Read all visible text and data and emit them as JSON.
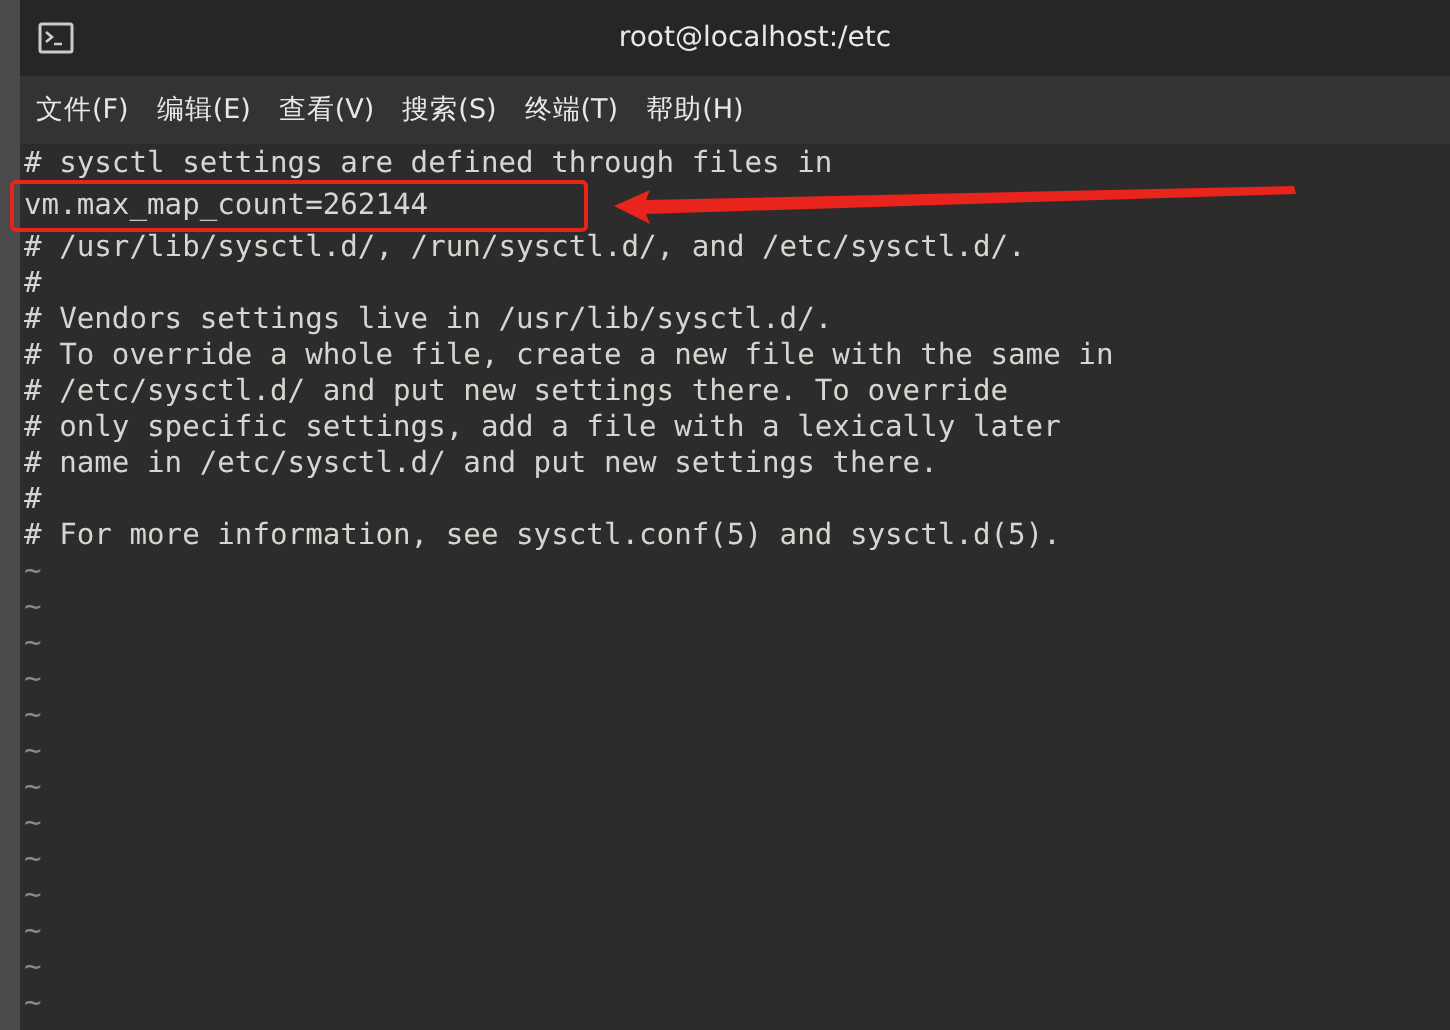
{
  "window": {
    "title": "root@localhost:/etc"
  },
  "menu": [
    "文件(F)",
    "编辑(E)",
    "查看(V)",
    "搜索(S)",
    "终端(T)",
    "帮助(H)"
  ],
  "lines": [
    {
      "text": "# sysctl settings are defined through files in",
      "highlighted": false
    },
    {
      "text": "vm.max_map_count=262144",
      "highlighted": true
    },
    {
      "text": "# /usr/lib/sysctl.d/, /run/sysctl.d/, and /etc/sysctl.d/.",
      "highlighted": false
    },
    {
      "text": "#",
      "highlighted": false
    },
    {
      "text": "# Vendors settings live in /usr/lib/sysctl.d/.",
      "highlighted": false
    },
    {
      "text": "# To override a whole file, create a new file with the same in",
      "highlighted": false
    },
    {
      "text": "# /etc/sysctl.d/ and put new settings there. To override",
      "highlighted": false
    },
    {
      "text": "# only specific settings, add a file with a lexically later",
      "highlighted": false
    },
    {
      "text": "# name in /etc/sysctl.d/ and put new settings there.",
      "highlighted": false
    },
    {
      "text": "#",
      "highlighted": false
    },
    {
      "text": "# For more information, see sysctl.conf(5) and sysctl.d(5).",
      "highlighted": false
    }
  ],
  "empty_lines": [
    "~",
    "~",
    "~",
    "~",
    "~",
    "~",
    "~",
    "~",
    "~",
    "~",
    "~",
    "~",
    "~"
  ]
}
